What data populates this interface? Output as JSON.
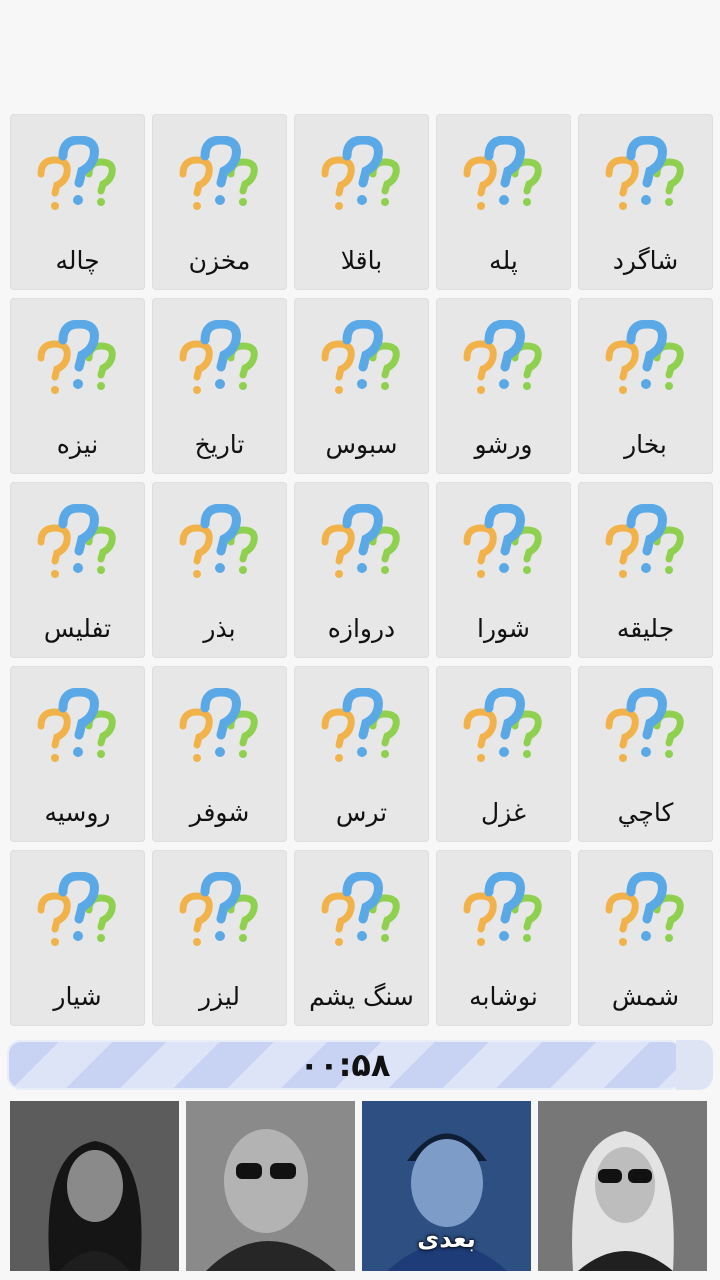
{
  "cards": [
    "شاگرد",
    "پله",
    "باقلا",
    "مخزن",
    "چاله",
    "بخار",
    "ورشو",
    "سبوس",
    "تاريخ",
    "نيزه",
    "جليقه",
    "شورا",
    "دروازه",
    "بذر",
    "تفليس",
    "کاچي",
    "غزل",
    "ترس",
    "شوفر",
    "روسيه",
    "شمش",
    "نوشابه",
    "سنگ يشم",
    "ليزر",
    "شيار"
  ],
  "card_icon": "question-marks-icon",
  "timer": {
    "text": "۰۰:۵۸"
  },
  "characters": [
    {
      "name": "character-woman-dark-hair",
      "label": ""
    },
    {
      "name": "character-bald-man-sunglasses",
      "label": ""
    },
    {
      "name": "character-man-blue-suit",
      "label": "بعدی",
      "active": true
    },
    {
      "name": "character-blonde-woman-sunglasses",
      "label": ""
    }
  ],
  "colors": {
    "q_orange": "#f2b24a",
    "q_blue": "#5aa9e6",
    "q_green": "#8fd14f",
    "card_bg": "#e7e7e7",
    "timer_bg": "#c8d3f3"
  }
}
